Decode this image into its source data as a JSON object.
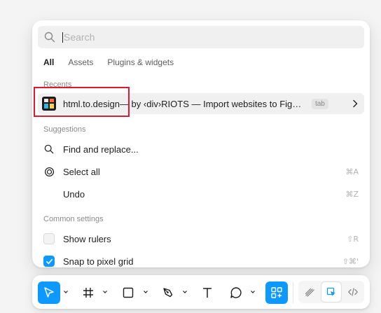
{
  "search": {
    "placeholder": "Search"
  },
  "tabs": [
    {
      "label": "All",
      "active": true
    },
    {
      "label": "Assets",
      "active": false
    },
    {
      "label": "Plugins & widgets",
      "active": false
    }
  ],
  "sections": {
    "recents": "Recents",
    "suggestions": "Suggestions",
    "common": "Common settings"
  },
  "recent_item": {
    "name": "html.to.design",
    "description": " — by ‹div›RIOTS — Import websites to Figma designs (web, html, css)",
    "badge": "tab",
    "icon": "html-to-design-plugin-icon"
  },
  "suggestions": [
    {
      "label": "Find and replace...",
      "shortcut": "",
      "icon": "search-icon"
    },
    {
      "label": "Select all",
      "shortcut": "⌘A",
      "icon": "target-icon"
    },
    {
      "label": "Undo",
      "shortcut": "⌘Z",
      "icon": ""
    }
  ],
  "settings": [
    {
      "label": "Show rulers",
      "shortcut": "⇧R",
      "checked": false
    },
    {
      "label": "Snap to pixel grid",
      "shortcut": "⇧⌘'",
      "checked": true
    }
  ],
  "toolbar": {
    "tools": [
      "move-tool",
      "frame-tool",
      "shape-tool",
      "pen-tool",
      "text-tool",
      "comment-tool",
      "actions-tool"
    ],
    "modes": [
      "draw-mode",
      "design-mode",
      "dev-mode"
    ],
    "accent": "#0d99ff"
  },
  "colors": {
    "accent": "#0d99ff",
    "highlight_border": "#e0192f"
  }
}
